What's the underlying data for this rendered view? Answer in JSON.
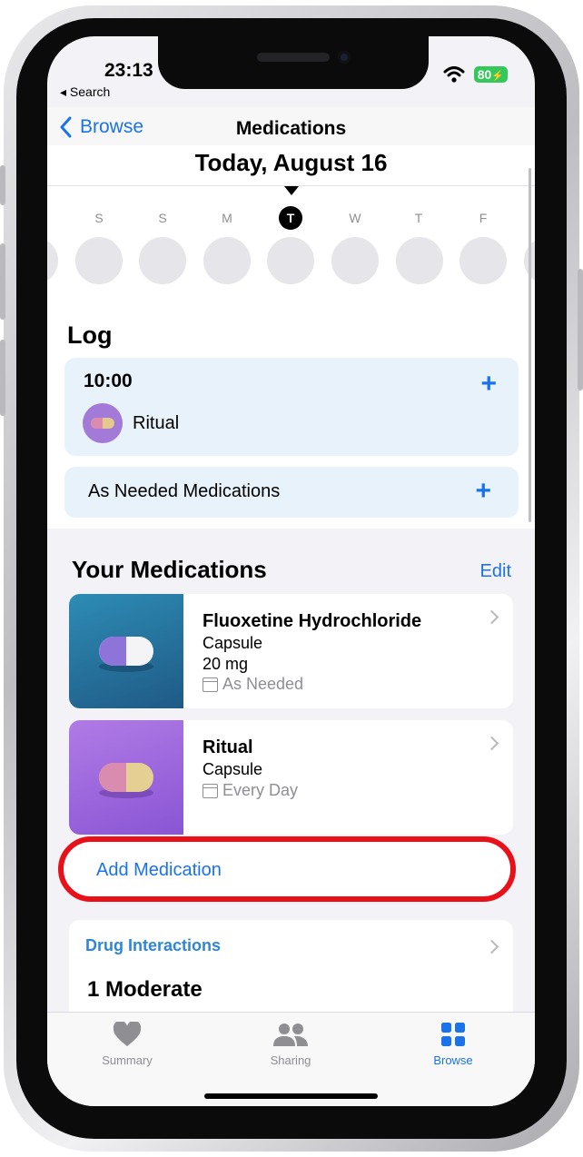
{
  "status": {
    "time": "23:13",
    "back_app": "◂ Search",
    "battery": "80"
  },
  "nav": {
    "back_label": "Browse",
    "title": "Medications"
  },
  "calendar": {
    "date_title": "Today, August 16",
    "days": [
      "S",
      "S",
      "M",
      "T",
      "W",
      "T",
      "F"
    ],
    "today_index": 3
  },
  "log": {
    "heading": "Log",
    "entry": {
      "time": "10:00",
      "medication": "Ritual"
    },
    "as_needed_label": "As Needed Medications"
  },
  "medications": {
    "heading": "Your Medications",
    "edit_label": "Edit",
    "items": [
      {
        "name": "Fluoxetine Hydrochloride",
        "form": "Capsule",
        "dose": "20 mg",
        "schedule": "As Needed"
      },
      {
        "name": "Ritual",
        "form": "Capsule",
        "schedule": "Every Day"
      }
    ],
    "add_label": "Add Medication"
  },
  "drug_interactions": {
    "label": "Drug Interactions",
    "summary": "1 Moderate"
  },
  "tabs": [
    {
      "label": "Summary",
      "icon": "heart-icon"
    },
    {
      "label": "Sharing",
      "icon": "people-icon"
    },
    {
      "label": "Browse",
      "icon": "grid-icon",
      "active": true
    }
  ],
  "colors": {
    "accent": "#1a73e8",
    "highlight_ring": "#e8111a",
    "log_card": "#e8f2fb"
  }
}
